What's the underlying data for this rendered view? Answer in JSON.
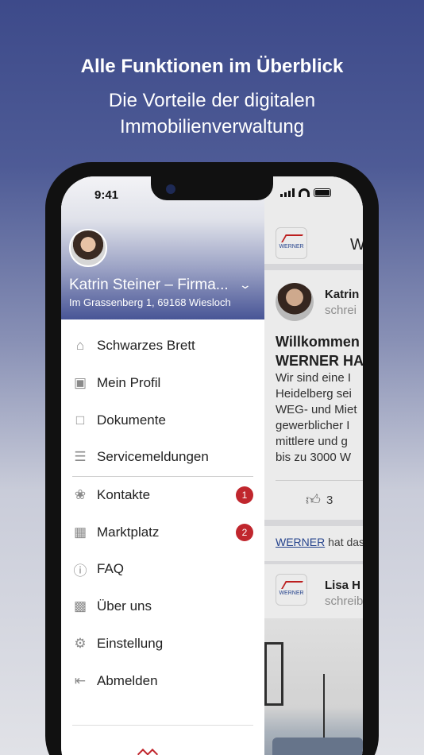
{
  "promo": {
    "title": "Alle Funktionen im Überblick",
    "subtitle": "Die Vorteile der digitalen\nImmobilienverwaltung"
  },
  "status_bar": {
    "time": "9:41"
  },
  "drawer": {
    "user_name": "Katrin Steiner – Firma...",
    "address": "Im Grassenberg 1, 69168 Wiesloch",
    "items": [
      {
        "label": "Schwarzes Brett",
        "icon": "home-icon"
      },
      {
        "label": "Mein Profil",
        "icon": "profile-card-icon"
      },
      {
        "label": "Dokumente",
        "icon": "document-icon"
      },
      {
        "label": "Servicemeldungen",
        "icon": "service-report-icon"
      },
      {
        "label": "Kontakte",
        "icon": "contacts-icon",
        "badge": "1"
      },
      {
        "label": "Marktplatz",
        "icon": "store-icon",
        "badge": "2"
      },
      {
        "label": "FAQ",
        "icon": "question-icon"
      },
      {
        "label": "Über uns",
        "icon": "building-icon"
      },
      {
        "label": "Einstellung",
        "icon": "gear-icon"
      },
      {
        "label": "Abmelden",
        "icon": "logout-icon"
      }
    ]
  },
  "feed": {
    "logo_text": "WERNER",
    "header_partial": "W",
    "post": {
      "author": "Katrin",
      "sub": "schrei",
      "title": "Willkommen\nWERNER HA",
      "text": "Wir sind eine I\nHeidelberg sei\nWEG- und Miet\ngewerblicher I\nmittlere und g\nbis zu 3000 W",
      "likes": "3"
    },
    "activity_link": "WERNER",
    "activity_text": " hat das",
    "post2": {
      "author": "Lisa H",
      "sub": "schreib"
    }
  },
  "colors": {
    "brand_blue": "#485596",
    "badge_red": "#c0262d",
    "link_blue": "#2a4a9a"
  }
}
